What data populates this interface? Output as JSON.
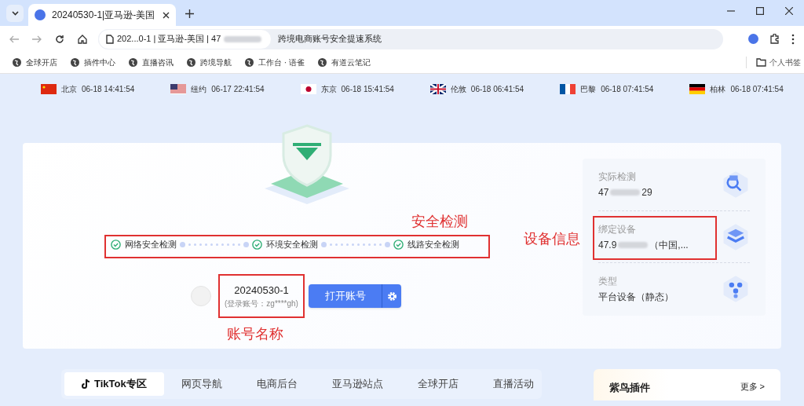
{
  "browser": {
    "tab_title": "20240530-1|亚马逊-美国",
    "address_prefix": "202...0-1 | 亚马逊-美国 | 47",
    "page_title": "跨境电商账号安全提速系统",
    "bookmarks": [
      "全球开店",
      "插件中心",
      "直播咨讯",
      "跨境导航",
      "工作台 · 语雀",
      "有道云笔记"
    ],
    "bookmark_folder": "个人书签"
  },
  "clocks": [
    {
      "kind": "cn",
      "city": "北京",
      "time": "06-18 14:41:54"
    },
    {
      "kind": "us",
      "city": "纽约",
      "time": "06-17 22:41:54"
    },
    {
      "kind": "jp",
      "city": "东京",
      "time": "06-18 15:41:54"
    },
    {
      "kind": "uk",
      "city": "伦敦",
      "time": "06-18 06:41:54"
    },
    {
      "kind": "fr",
      "city": "巴黎",
      "time": "06-18 07:41:54"
    },
    {
      "kind": "de",
      "city": "柏林",
      "time": "06-18 07:41:54"
    }
  ],
  "checks": [
    {
      "label": "网络安全检测",
      "passed": true
    },
    {
      "label": "环境安全检测",
      "passed": true
    },
    {
      "label": "线路安全检测",
      "passed": true
    }
  ],
  "account": {
    "name": "20240530-1",
    "login": "(登录账号：zg****gh)",
    "open_button": "打开账号"
  },
  "device_info": [
    {
      "kind": "search",
      "label": "实际检测",
      "value_start": "47",
      "value_end": "29"
    },
    {
      "kind": "layers",
      "label": "绑定设备",
      "value_start": "47.9",
      "value_end": "（中国,..."
    },
    {
      "kind": "nodes",
      "label": "类型",
      "value_start": "平台设备（静态）"
    }
  ],
  "annotations": [
    "安全检测",
    "设备信息",
    "账号名称"
  ],
  "nav_tabs": [
    {
      "label": "TikTok专区",
      "selected": true
    },
    {
      "label": "网页导航",
      "selected": false
    },
    {
      "label": "电商后台",
      "selected": false
    },
    {
      "label": "亚马逊站点",
      "selected": false
    },
    {
      "label": "全球开店",
      "selected": false
    },
    {
      "label": "直播活动",
      "selected": false
    }
  ],
  "plugin_card": {
    "title": "紫鸟插件",
    "more": "更多 >"
  }
}
